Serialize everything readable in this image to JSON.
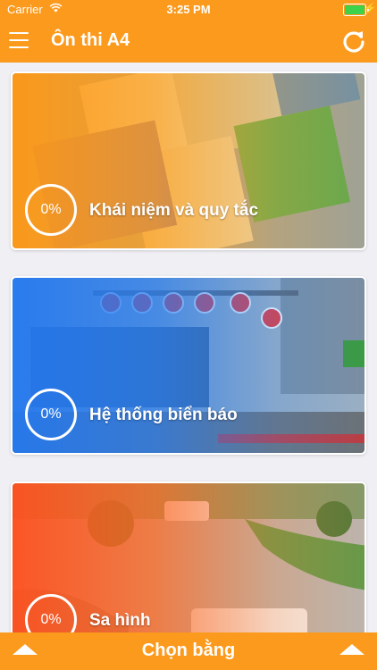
{
  "status_bar": {
    "carrier": "Carrier",
    "time": "3:25 PM"
  },
  "header": {
    "title": "Ôn thi A4"
  },
  "cards": [
    {
      "percent": "0%",
      "title": "Khái niệm và quy tắc"
    },
    {
      "percent": "0%",
      "title": "Hệ thống biển báo"
    },
    {
      "percent": "0%",
      "title": "Sa hình"
    }
  ],
  "bottom_bar": {
    "label": "Chọn bằng"
  },
  "colors": {
    "accent": "#fb9a1c",
    "card1": "#f7a21e",
    "card2": "#2f7ff0",
    "card3": "#ff6a1f"
  }
}
